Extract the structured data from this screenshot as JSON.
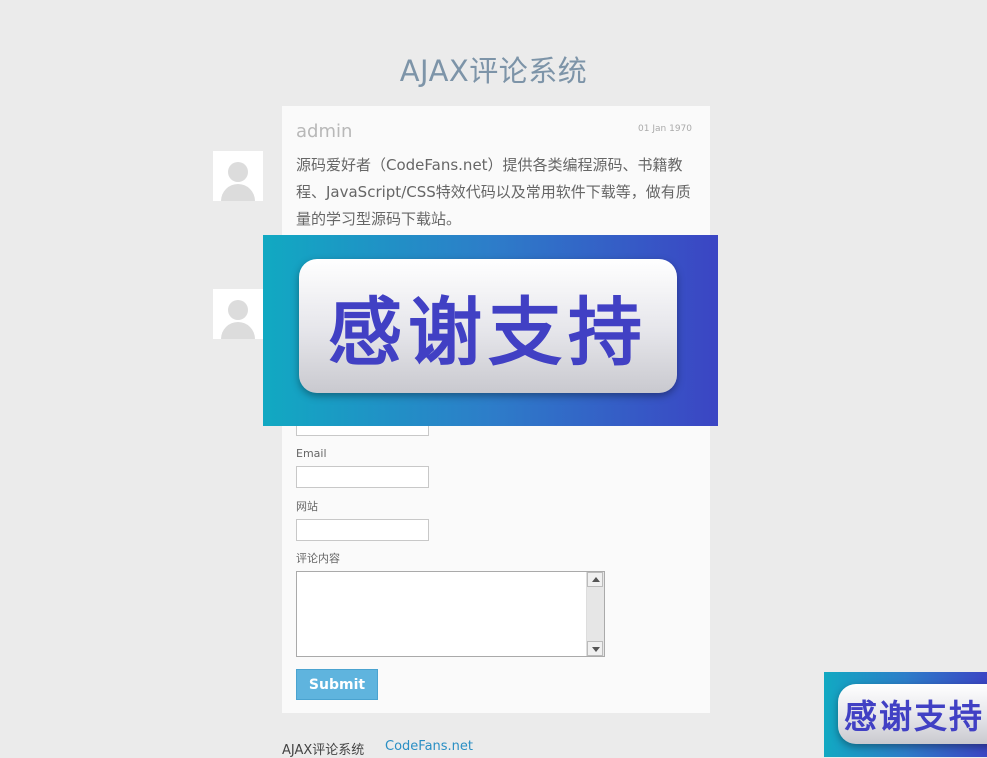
{
  "page": {
    "title": "AJAX评论系统"
  },
  "comments": [
    {
      "author": "admin",
      "date": "01 Jan 1970",
      "text": "源码爱好者（CodeFans.net）提供各类编程源码、书籍教程、JavaScript/CSS特效代码以及常用软件下载等，做有质量的学习型源码下载站。"
    }
  ],
  "form": {
    "email_label": "Email",
    "website_label": "网站",
    "content_label": "评论内容",
    "submit_label": "Submit"
  },
  "footer": {
    "text": "AJAX评论系统",
    "link": "CodeFans.net"
  },
  "overlay": {
    "banner_text": "感谢支持",
    "corner_text": "感谢支持"
  },
  "colors": {
    "title": "#7d94a8",
    "submit": "#5fb4de",
    "link": "#2a8fc4",
    "banner_text": "#4140c4"
  },
  "icons": {
    "avatar": "user-avatar-icon",
    "scroll_up": "arrow-up-icon",
    "scroll_down": "arrow-down-icon"
  }
}
